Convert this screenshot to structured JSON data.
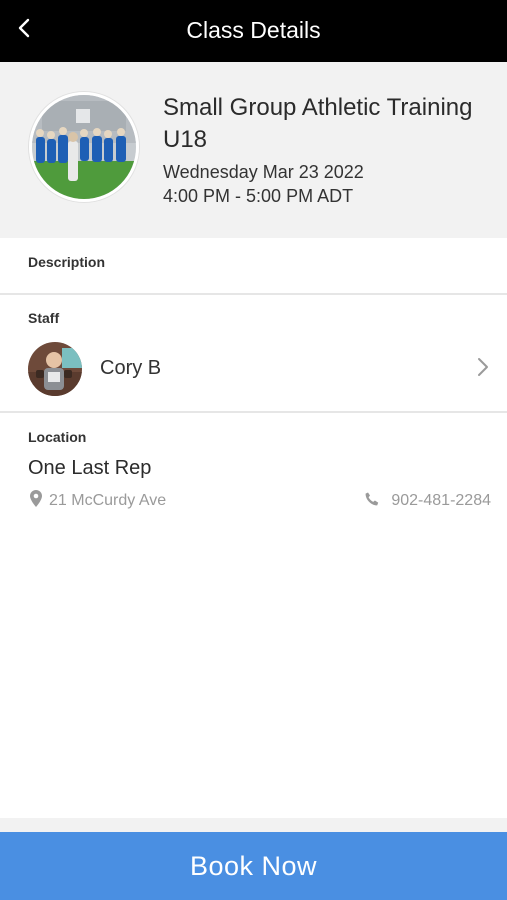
{
  "app": {
    "title": "Class Details",
    "back_icon": "chevron-left-icon"
  },
  "class": {
    "name": "Small Group Athletic Training U18",
    "date": "Wednesday Mar 23 2022",
    "time": "4:00 PM - 5:00 PM ADT"
  },
  "description": {
    "label": "Description"
  },
  "staff": {
    "label": "Staff",
    "name": "Cory B",
    "chevron_icon": "chevron-right-icon"
  },
  "location": {
    "label": "Location",
    "name": "One Last Rep",
    "address": "21 McCurdy Ave",
    "phone": "902-481-2284",
    "address_icon": "map-pin-icon",
    "phone_icon": "phone-icon"
  },
  "actions": {
    "book_label": "Book Now"
  },
  "colors": {
    "topbar": "#000000",
    "header_bg": "#f2f2f2",
    "accent": "#4a8fe2",
    "muted_text": "#9a9a9a"
  }
}
